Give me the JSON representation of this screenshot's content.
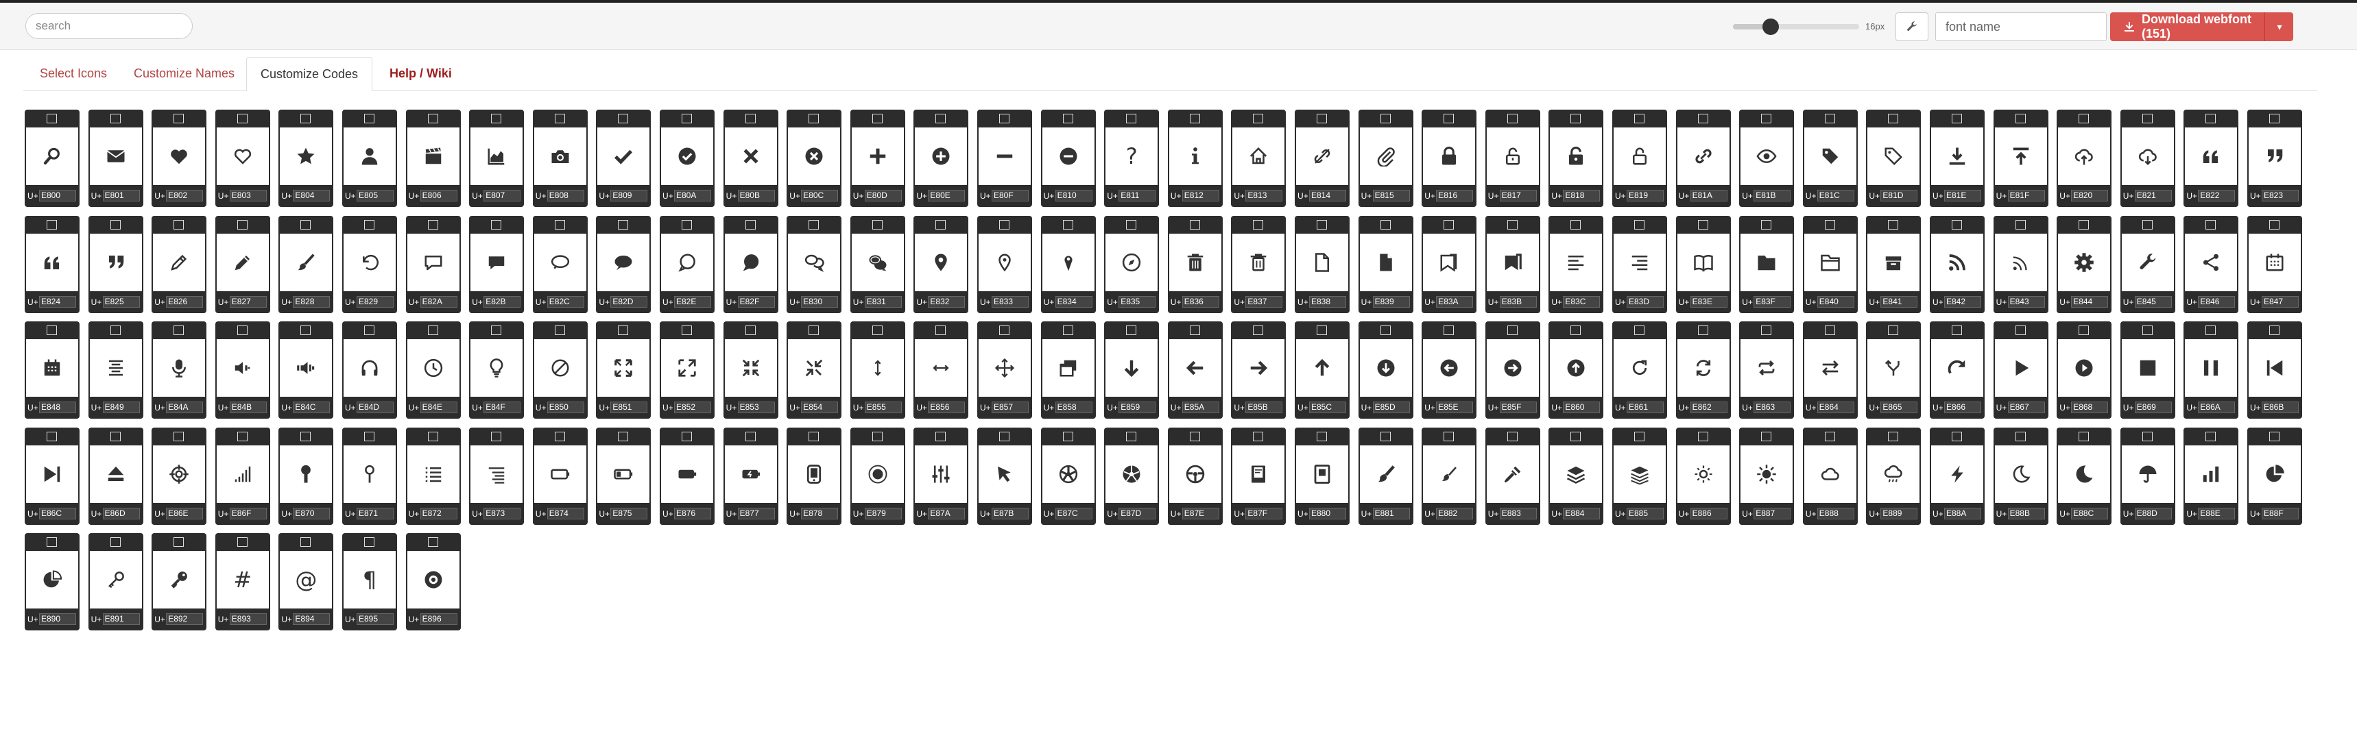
{
  "topbar": {
    "search_placeholder": "search",
    "size_label": "16px",
    "size_fraction": 0.3,
    "fontname_placeholder": "font name",
    "download_label": "Download webfont (151)",
    "caret_icon": "caret-down-icon"
  },
  "tabs": [
    {
      "label": "Select Icons",
      "active": false
    },
    {
      "label": "Customize Names",
      "active": false
    },
    {
      "label": "Customize Codes",
      "active": true
    },
    {
      "label": "Help / Wiki",
      "active": false
    }
  ],
  "colors": {
    "accent": "#d9534f",
    "cell_bg": "#2c2c2c",
    "tab_link": "#b04545"
  },
  "icons": [
    {
      "icon": "search",
      "code": "E800"
    },
    {
      "icon": "mail",
      "code": "E801"
    },
    {
      "icon": "heart",
      "code": "E802"
    },
    {
      "icon": "heart-empty",
      "code": "E803"
    },
    {
      "icon": "star",
      "code": "E804"
    },
    {
      "icon": "user",
      "code": "E805"
    },
    {
      "icon": "film",
      "code": "E806"
    },
    {
      "icon": "chart-area",
      "code": "E807"
    },
    {
      "icon": "camera",
      "code": "E808"
    },
    {
      "icon": "ok",
      "code": "E809"
    },
    {
      "icon": "ok-circled",
      "code": "E80A"
    },
    {
      "icon": "cancel",
      "code": "E80B"
    },
    {
      "icon": "cancel-circled",
      "code": "E80C"
    },
    {
      "icon": "plus",
      "code": "E80D"
    },
    {
      "icon": "plus-circled",
      "code": "E80E"
    },
    {
      "icon": "minus",
      "code": "E80F"
    },
    {
      "icon": "minus-circled",
      "code": "E810"
    },
    {
      "icon": "help",
      "code": "E811"
    },
    {
      "icon": "info",
      "code": "E812"
    },
    {
      "icon": "home",
      "code": "E813"
    },
    {
      "icon": "link-off",
      "code": "E814"
    },
    {
      "icon": "attach",
      "code": "E815"
    },
    {
      "icon": "lock",
      "code": "E816"
    },
    {
      "icon": "lock-open",
      "code": "E817"
    },
    {
      "icon": "lock-filled",
      "code": "E818"
    },
    {
      "icon": "lock-open-alt",
      "code": "E819"
    },
    {
      "icon": "link",
      "code": "E81A"
    },
    {
      "icon": "eye",
      "code": "E81B"
    },
    {
      "icon": "tag",
      "code": "E81C"
    },
    {
      "icon": "tag-empty",
      "code": "E81D"
    },
    {
      "icon": "download",
      "code": "E81E"
    },
    {
      "icon": "upload",
      "code": "E81F"
    },
    {
      "icon": "cloud-up",
      "code": "E820"
    },
    {
      "icon": "cloud-down",
      "code": "E821"
    },
    {
      "icon": "quote-left",
      "code": "E822"
    },
    {
      "icon": "quote-right",
      "code": "E823"
    },
    {
      "icon": "quote-left",
      "code": "E824"
    },
    {
      "icon": "quote-right",
      "code": "E825"
    },
    {
      "icon": "pencil",
      "code": "E826"
    },
    {
      "icon": "pencil-alt",
      "code": "E827"
    },
    {
      "icon": "brush",
      "code": "E828"
    },
    {
      "icon": "undo",
      "code": "E829"
    },
    {
      "icon": "comment-empty",
      "code": "E82A"
    },
    {
      "icon": "comment",
      "code": "E82B"
    },
    {
      "icon": "chat-empty",
      "code": "E82C"
    },
    {
      "icon": "chat",
      "code": "E82D"
    },
    {
      "icon": "comment-round-empty",
      "code": "E82E"
    },
    {
      "icon": "comment-round",
      "code": "E82F"
    },
    {
      "icon": "chat-bubbles-empty",
      "code": "E830"
    },
    {
      "icon": "chat-bubbles",
      "code": "E831"
    },
    {
      "icon": "location",
      "code": "E832"
    },
    {
      "icon": "location-empty",
      "code": "E833"
    },
    {
      "icon": "location-alt",
      "code": "E834"
    },
    {
      "icon": "compass",
      "code": "E835"
    },
    {
      "icon": "trash",
      "code": "E836"
    },
    {
      "icon": "trash-empty",
      "code": "E837"
    },
    {
      "icon": "doc-empty",
      "code": "E838"
    },
    {
      "icon": "doc",
      "code": "E839"
    },
    {
      "icon": "bookmark-empty",
      "code": "E83A"
    },
    {
      "icon": "bookmark",
      "code": "E83B"
    },
    {
      "icon": "align-left",
      "code": "E83C"
    },
    {
      "icon": "align-right",
      "code": "E83D"
    },
    {
      "icon": "book-open",
      "code": "E83E"
    },
    {
      "icon": "folder",
      "code": "E83F"
    },
    {
      "icon": "folder-open",
      "code": "E840"
    },
    {
      "icon": "box",
      "code": "E841"
    },
    {
      "icon": "rss",
      "code": "E842"
    },
    {
      "icon": "rss-alt",
      "code": "E843"
    },
    {
      "icon": "cog",
      "code": "E844"
    },
    {
      "icon": "wrench",
      "code": "E845"
    },
    {
      "icon": "share",
      "code": "E846"
    },
    {
      "icon": "calendar-empty",
      "code": "E847"
    },
    {
      "icon": "calendar",
      "code": "E848"
    },
    {
      "icon": "list-centered",
      "code": "E849"
    },
    {
      "icon": "mic",
      "code": "E84A"
    },
    {
      "icon": "volume-low",
      "code": "E84B"
    },
    {
      "icon": "volume-high",
      "code": "E84C"
    },
    {
      "icon": "headphones",
      "code": "E84D"
    },
    {
      "icon": "clock",
      "code": "E84E"
    },
    {
      "icon": "lightbulb",
      "code": "E84F"
    },
    {
      "icon": "block",
      "code": "E850"
    },
    {
      "icon": "resize-full",
      "code": "E851"
    },
    {
      "icon": "resize-full-alt",
      "code": "E852"
    },
    {
      "icon": "resize-small",
      "code": "E853"
    },
    {
      "icon": "resize-small-alt",
      "code": "E854"
    },
    {
      "icon": "resize-vertical",
      "code": "E855"
    },
    {
      "icon": "resize-horizontal",
      "code": "E856"
    },
    {
      "icon": "move",
      "code": "E857"
    },
    {
      "icon": "popup",
      "code": "E858"
    },
    {
      "icon": "down",
      "code": "E859"
    },
    {
      "icon": "left",
      "code": "E85A"
    },
    {
      "icon": "right",
      "code": "E85B"
    },
    {
      "icon": "up",
      "code": "E85C"
    },
    {
      "icon": "down-circled",
      "code": "E85D"
    },
    {
      "icon": "left-circled",
      "code": "E85E"
    },
    {
      "icon": "right-circled",
      "code": "E85F"
    },
    {
      "icon": "up-circled",
      "code": "E860"
    },
    {
      "icon": "cw",
      "code": "E861"
    },
    {
      "icon": "arrows-cw",
      "code": "E862"
    },
    {
      "icon": "loop",
      "code": "E863"
    },
    {
      "icon": "exchange",
      "code": "E864"
    },
    {
      "icon": "split",
      "code": "E865"
    },
    {
      "icon": "redo",
      "code": "E866"
    },
    {
      "icon": "play",
      "code": "E867"
    },
    {
      "icon": "play-circled",
      "code": "E868"
    },
    {
      "icon": "stop",
      "code": "E869"
    },
    {
      "icon": "pause",
      "code": "E86A"
    },
    {
      "icon": "to-start",
      "code": "E86B"
    },
    {
      "icon": "to-end",
      "code": "E86C"
    },
    {
      "icon": "eject",
      "code": "E86D"
    },
    {
      "icon": "target",
      "code": "E86E"
    },
    {
      "icon": "signal",
      "code": "E86F"
    },
    {
      "icon": "pin",
      "code": "E870"
    },
    {
      "icon": "pin-empty",
      "code": "E871"
    },
    {
      "icon": "list",
      "code": "E872"
    },
    {
      "icon": "list-nested",
      "code": "E873"
    },
    {
      "icon": "battery-empty",
      "code": "E874"
    },
    {
      "icon": "battery-low",
      "code": "E875"
    },
    {
      "icon": "battery-full",
      "code": "E876"
    },
    {
      "icon": "battery-charge",
      "code": "E877"
    },
    {
      "icon": "mobile",
      "code": "E878"
    },
    {
      "icon": "record",
      "code": "E879"
    },
    {
      "icon": "sliders",
      "code": "E87A"
    },
    {
      "icon": "cursor",
      "code": "E87B"
    },
    {
      "icon": "aperture",
      "code": "E87C"
    },
    {
      "icon": "aperture-alt",
      "code": "E87D"
    },
    {
      "icon": "steering-wheel",
      "code": "E87E"
    },
    {
      "icon": "book",
      "code": "E87F"
    },
    {
      "icon": "book-alt",
      "code": "E880"
    },
    {
      "icon": "brush-alt",
      "code": "E881"
    },
    {
      "icon": "brush-thin",
      "code": "E882"
    },
    {
      "icon": "eyedropper",
      "code": "E883"
    },
    {
      "icon": "layers",
      "code": "E884"
    },
    {
      "icon": "layers-alt",
      "code": "E885"
    },
    {
      "icon": "sun-empty",
      "code": "E886"
    },
    {
      "icon": "sun",
      "code": "E887"
    },
    {
      "icon": "cloud",
      "code": "E888"
    },
    {
      "icon": "rain",
      "code": "E889"
    },
    {
      "icon": "flash",
      "code": "E88A"
    },
    {
      "icon": "moon-empty",
      "code": "E88B"
    },
    {
      "icon": "moon",
      "code": "E88C"
    },
    {
      "icon": "umbrella",
      "code": "E88D"
    },
    {
      "icon": "chart-bar",
      "code": "E88E"
    },
    {
      "icon": "chart-pie",
      "code": "E88F"
    },
    {
      "icon": "chart-pie-alt",
      "code": "E890"
    },
    {
      "icon": "key-empty",
      "code": "E891"
    },
    {
      "icon": "key",
      "code": "E892"
    },
    {
      "icon": "hash",
      "code": "E893"
    },
    {
      "icon": "at",
      "code": "E894"
    },
    {
      "icon": "pilcrow",
      "code": "E895"
    },
    {
      "icon": "dial",
      "code": "E896"
    }
  ],
  "code_prefix": "U+"
}
